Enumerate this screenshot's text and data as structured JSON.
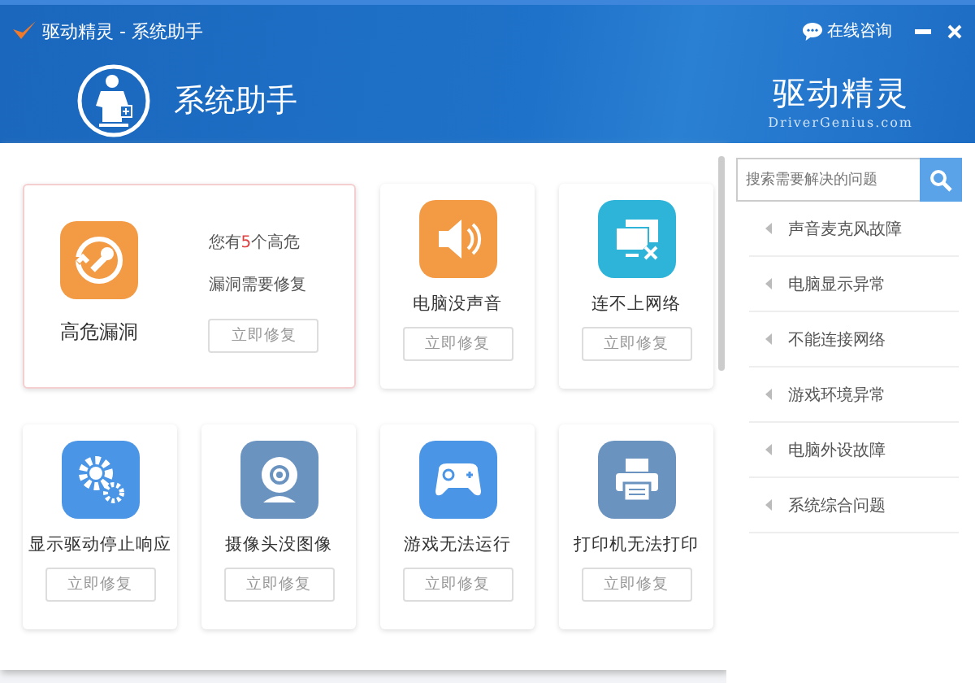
{
  "window": {
    "title": "驱动精灵 - 系统助手",
    "consult": "在线咨询"
  },
  "header": {
    "title": "系统助手",
    "brand": "驱动精灵",
    "brand_sub": "DriverGenius.com"
  },
  "cards": [
    {
      "kind": "featured",
      "label": "高危漏洞",
      "color": "#f39a45",
      "summary_before": "您有",
      "summary_count": "5",
      "summary_after": "个高危",
      "summary_line2": "漏洞需要修复",
      "button": "立即修复"
    },
    {
      "kind": "normal",
      "label": "电脑没声音",
      "color": "#f39a45",
      "button": "立即修复"
    },
    {
      "kind": "normal",
      "label": "连不上网络",
      "color": "#2fb4d9",
      "button": "立即修复"
    },
    {
      "kind": "normal",
      "label": "显示驱动停止响应",
      "color": "#4a95e6",
      "button": "立即修复"
    },
    {
      "kind": "normal",
      "label": "摄像头没图像",
      "color": "#6a93c0",
      "button": "立即修复"
    },
    {
      "kind": "normal",
      "label": "游戏无法运行",
      "color": "#4a95e6",
      "button": "立即修复"
    },
    {
      "kind": "normal",
      "label": "打印机无法打印",
      "color": "#6a93c0",
      "button": "立即修复"
    }
  ],
  "sidebar": {
    "search": {
      "placeholder": "搜索需要解决的问题"
    },
    "items": [
      "声音麦克风故障",
      "电脑显示异常",
      "不能连接网络",
      "游戏环境异常",
      "电脑外设故障",
      "系统综合问题"
    ]
  }
}
